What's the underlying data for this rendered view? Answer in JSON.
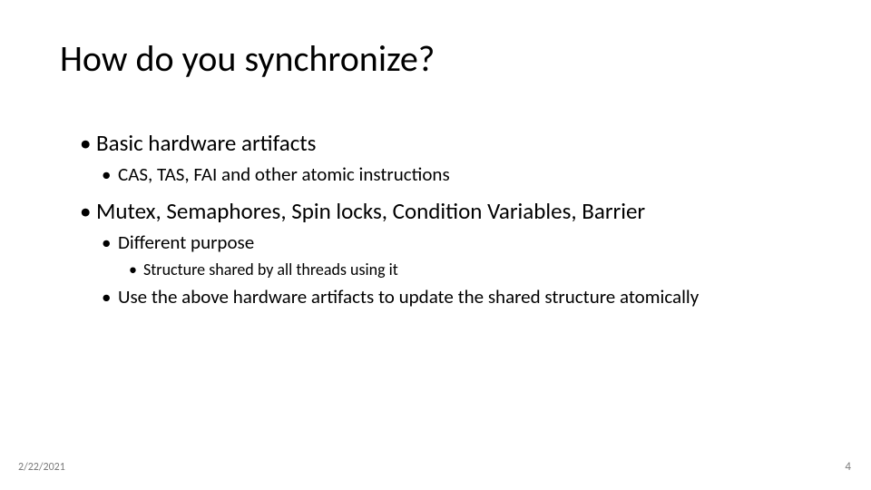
{
  "title": "How do you synchronize?",
  "bullets": {
    "b1": "Basic hardware artifacts",
    "b1_1": "CAS, TAS, FAI and other atomic instructions",
    "b2": "Mutex, Semaphores, Spin locks, Condition Variables, Barrier",
    "b2_1": "Different purpose",
    "b2_1_1": "Structure shared by all threads using it",
    "b2_2": "Use the above hardware artifacts to update the shared structure atomically"
  },
  "footer": {
    "date": "2/22/2021",
    "page": "4"
  }
}
